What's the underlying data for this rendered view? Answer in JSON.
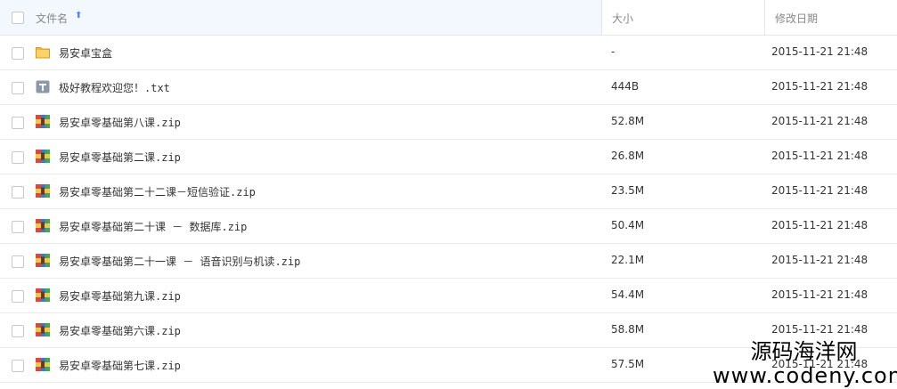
{
  "header": {
    "name_label": "文件名",
    "sort_arrow": "⬆",
    "size_label": "大小",
    "date_label": "修改日期"
  },
  "files": [
    {
      "icon": "folder-icon",
      "name": "易安卓宝盒",
      "size": "-",
      "date": "2015-11-21 21:48"
    },
    {
      "icon": "text-file-icon",
      "name": "极好教程欢迎您！.txt",
      "size": "444B",
      "date": "2015-11-21 21:48"
    },
    {
      "icon": "zip-file-icon",
      "name": "易安卓零基础第八课.zip",
      "size": "52.8M",
      "date": "2015-11-21 21:48"
    },
    {
      "icon": "zip-file-icon",
      "name": "易安卓零基础第二课.zip",
      "size": "26.8M",
      "date": "2015-11-21 21:48"
    },
    {
      "icon": "zip-file-icon",
      "name": "易安卓零基础第二十二课－短信验证.zip",
      "size": "23.5M",
      "date": "2015-11-21 21:48"
    },
    {
      "icon": "zip-file-icon",
      "name": "易安卓零基础第二十课 － 数据库.zip",
      "size": "50.4M",
      "date": "2015-11-21 21:48"
    },
    {
      "icon": "zip-file-icon",
      "name": "易安卓零基础第二十一课 － 语音识别与机读.zip",
      "size": "22.1M",
      "date": "2015-11-21 21:48"
    },
    {
      "icon": "zip-file-icon",
      "name": "易安卓零基础第九课.zip",
      "size": "54.4M",
      "date": "2015-11-21 21:48"
    },
    {
      "icon": "zip-file-icon",
      "name": "易安卓零基础第六课.zip",
      "size": "58.8M",
      "date": "2015-11-21 21:48"
    },
    {
      "icon": "zip-file-icon",
      "name": "易安卓零基础第七课.zip",
      "size": "57.5M",
      "date": "2015-11-21 21:48"
    }
  ],
  "watermark": {
    "text_cn": "源码海洋网",
    "url": "www.codeny.com"
  },
  "colors": {
    "header_bg": "#f2f8fd",
    "sort_arrow": "#3b8cff",
    "folder": "#f7c34a",
    "text_icon": "#8a9aaa"
  }
}
